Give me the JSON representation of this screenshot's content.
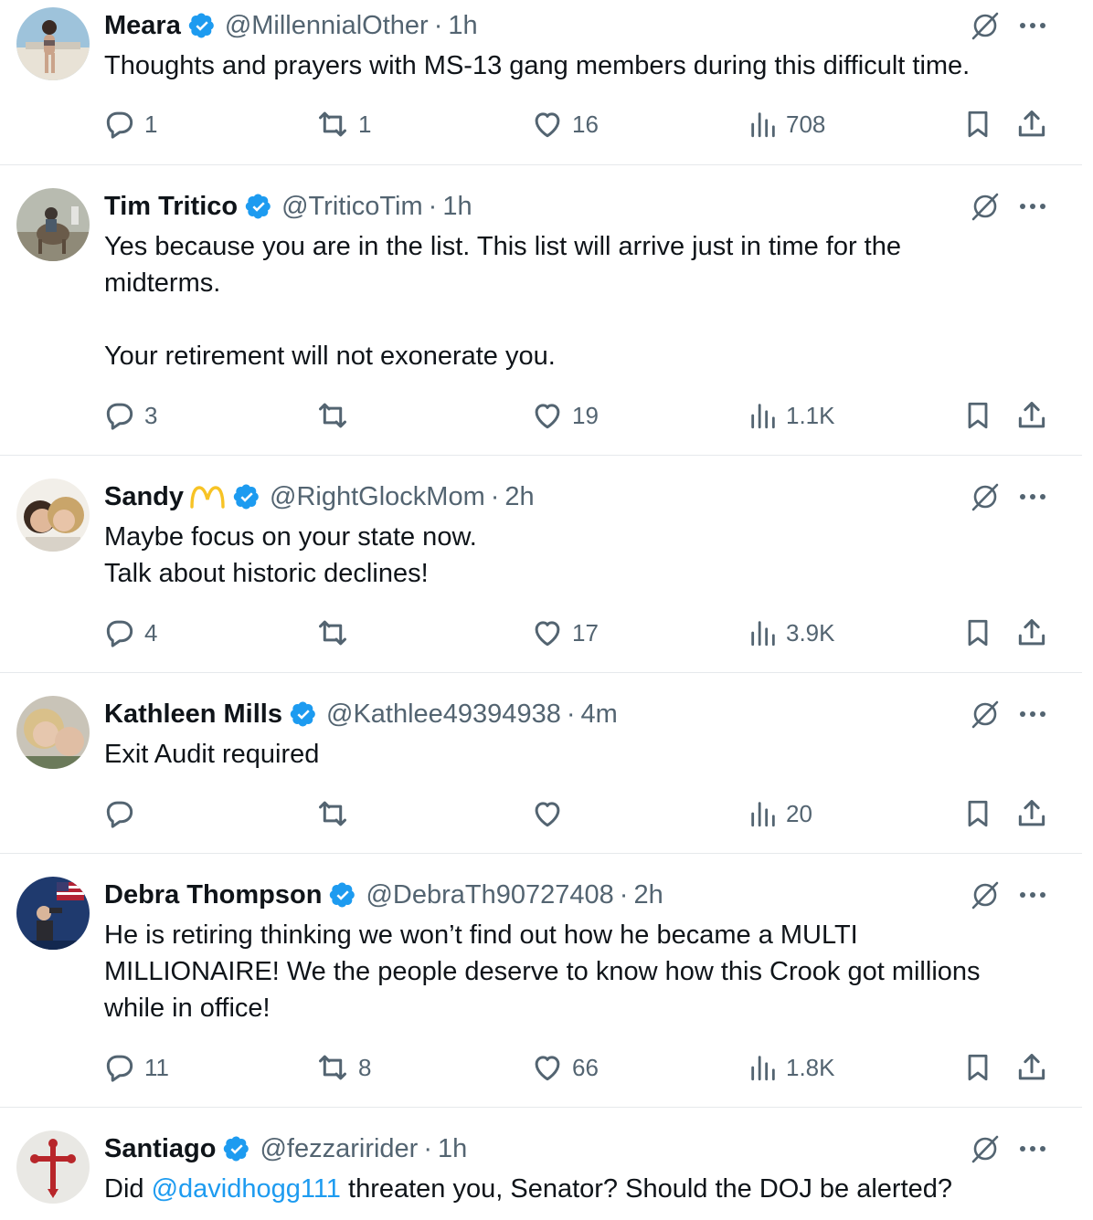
{
  "tweets": [
    {
      "name": "Meara",
      "emoji": "",
      "handle": "@MillennialOther",
      "time": "1h",
      "body": [
        "Thoughts and prayers with MS-13 gang members during this difficult time."
      ],
      "mention": "",
      "body_after_mention": "",
      "replies": "1",
      "reposts": "1",
      "likes": "16",
      "views": "708"
    },
    {
      "name": "Tim Tritico",
      "emoji": "",
      "handle": "@TriticoTim",
      "time": "1h",
      "body": [
        "Yes because you are in the list. This list will arrive just in time for the midterms.",
        "",
        "Your retirement will not exonerate you."
      ],
      "mention": "",
      "body_after_mention": "",
      "replies": "3",
      "reposts": "",
      "likes": "19",
      "views": "1.1K"
    },
    {
      "name": "Sandy",
      "emoji": "mcdonalds-arches",
      "handle": "@RightGlockMom",
      "time": "2h",
      "body": [
        "Maybe focus on your state now.",
        "Talk about historic declines!"
      ],
      "mention": "",
      "body_after_mention": "",
      "replies": "4",
      "reposts": "",
      "likes": "17",
      "views": "3.9K"
    },
    {
      "name": "Kathleen Mills",
      "emoji": "",
      "handle": "@Kathlee49394938",
      "time": "4m",
      "body": [
        "Exit Audit required"
      ],
      "mention": "",
      "body_after_mention": "",
      "replies": "",
      "reposts": "",
      "likes": "",
      "views": "20"
    },
    {
      "name": "Debra Thompson",
      "emoji": "",
      "handle": "@DebraTh90727408",
      "time": "2h",
      "body": [
        "He is retiring thinking we won’t find out how he became a MULTI MILLIONAIRE! We the people deserve to know how this Crook got millions while in office!"
      ],
      "mention": "",
      "body_after_mention": "",
      "replies": "11",
      "reposts": "8",
      "likes": "66",
      "views": "1.8K"
    },
    {
      "name": "Santiago",
      "emoji": "",
      "handle": "@fezzaririder",
      "time": "1h",
      "body_before_mention": "Did ",
      "mention": "@davidhogg111",
      "body_after_mention": " threaten you, Senator? Should the DOJ be alerted?",
      "replies": "",
      "reposts": "",
      "likes": "",
      "views": ""
    }
  ],
  "separator": "·",
  "colors": {
    "verified": "#1d9bf0",
    "text": "#0f1419",
    "secondary": "#536471",
    "link": "#1d9bf0",
    "divider": "#e6e9ec",
    "emoji": "#f7c325"
  },
  "icons": [
    "verified-badge-icon",
    "grok-icon",
    "more-icon",
    "reply-icon",
    "repost-icon",
    "like-icon",
    "views-icon",
    "bookmark-icon",
    "share-icon"
  ]
}
